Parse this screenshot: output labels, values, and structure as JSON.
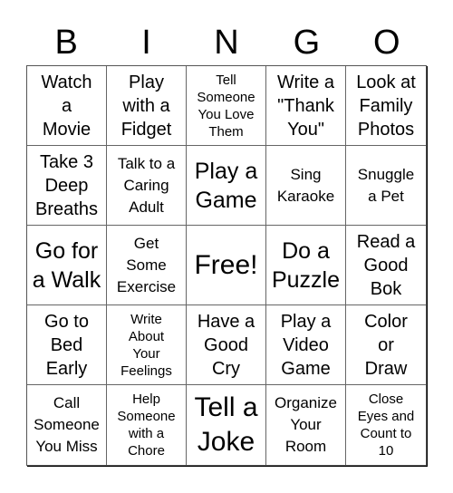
{
  "header": {
    "letters": [
      "B",
      "I",
      "N",
      "G",
      "O"
    ]
  },
  "cells": [
    {
      "text": "Watch\na\nMovie",
      "size": "fs-m"
    },
    {
      "text": "Play\nwith a\nFidget",
      "size": "fs-m"
    },
    {
      "text": "Tell\nSomeone\nYou Love\nThem",
      "size": "fs-xs"
    },
    {
      "text": "Write a\n\"Thank\nYou\"",
      "size": "fs-m"
    },
    {
      "text": "Look at\nFamily\nPhotos",
      "size": "fs-m"
    },
    {
      "text": "Take 3\nDeep\nBreaths",
      "size": "fs-m"
    },
    {
      "text": "Talk to a\nCaring\nAdult",
      "size": "fs-s"
    },
    {
      "text": "Play a\nGame",
      "size": "fs-l"
    },
    {
      "text": "Sing\nKaraoke",
      "size": "fs-s"
    },
    {
      "text": "Snuggle\na Pet",
      "size": "fs-s"
    },
    {
      "text": "Go for\na Walk",
      "size": "fs-l"
    },
    {
      "text": "Get\nSome\nExercise",
      "size": "fs-s"
    },
    {
      "text": "Free!",
      "size": "fs-xl"
    },
    {
      "text": "Do a\nPuzzle",
      "size": "fs-l"
    },
    {
      "text": "Read a\nGood\nBok",
      "size": "fs-m"
    },
    {
      "text": "Go to\nBed\nEarly",
      "size": "fs-m"
    },
    {
      "text": "Write\nAbout\nYour\nFeelings",
      "size": "fs-xs"
    },
    {
      "text": "Have a\nGood\nCry",
      "size": "fs-m"
    },
    {
      "text": "Play a\nVideo\nGame",
      "size": "fs-m"
    },
    {
      "text": "Color\nor\nDraw",
      "size": "fs-m"
    },
    {
      "text": "Call\nSomeone\nYou Miss",
      "size": "fs-s"
    },
    {
      "text": "Help\nSomeone\nwith a\nChore",
      "size": "fs-xs"
    },
    {
      "text": "Tell a\nJoke",
      "size": "fs-xl"
    },
    {
      "text": "Organize\nYour\nRoom",
      "size": "fs-s"
    },
    {
      "text": "Close\nEyes and\nCount to\n10",
      "size": "fs-xs"
    }
  ]
}
